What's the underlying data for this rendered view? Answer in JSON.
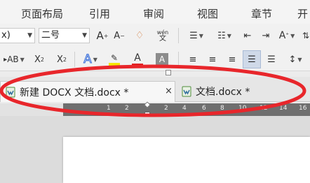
{
  "menu": {
    "items": [
      "页面布局",
      "引用",
      "审阅",
      "视图",
      "章节",
      "开"
    ]
  },
  "toolbar": {
    "font_name_partial": "x)",
    "font_size": "二号",
    "font_grow": "A",
    "font_shrink": "A",
    "pinyin": "wén",
    "text_effects": "AB",
    "superscript": "X",
    "superscript_mark": "2",
    "subscript": "X",
    "subscript_mark": "2",
    "font_color_letter": "A",
    "char_shading_letter": "A",
    "text_style": "A",
    "colors": {
      "font_color_bar": "#e02020",
      "highlight_bar": "#f5e600",
      "shading_box": "#8c8c8c",
      "text_style_blue": "#3b6fd8"
    }
  },
  "tabs": [
    {
      "title": "新建 DOCX 文档.docx *",
      "close": "×",
      "active": true
    },
    {
      "title": "文档.docx *",
      "active": false
    }
  ],
  "ruler": {
    "ticks": [
      "1",
      "2",
      "",
      "2",
      "4",
      "6",
      "8",
      "10",
      "12",
      "14",
      "16"
    ]
  },
  "annotation_color": "#e8262b"
}
